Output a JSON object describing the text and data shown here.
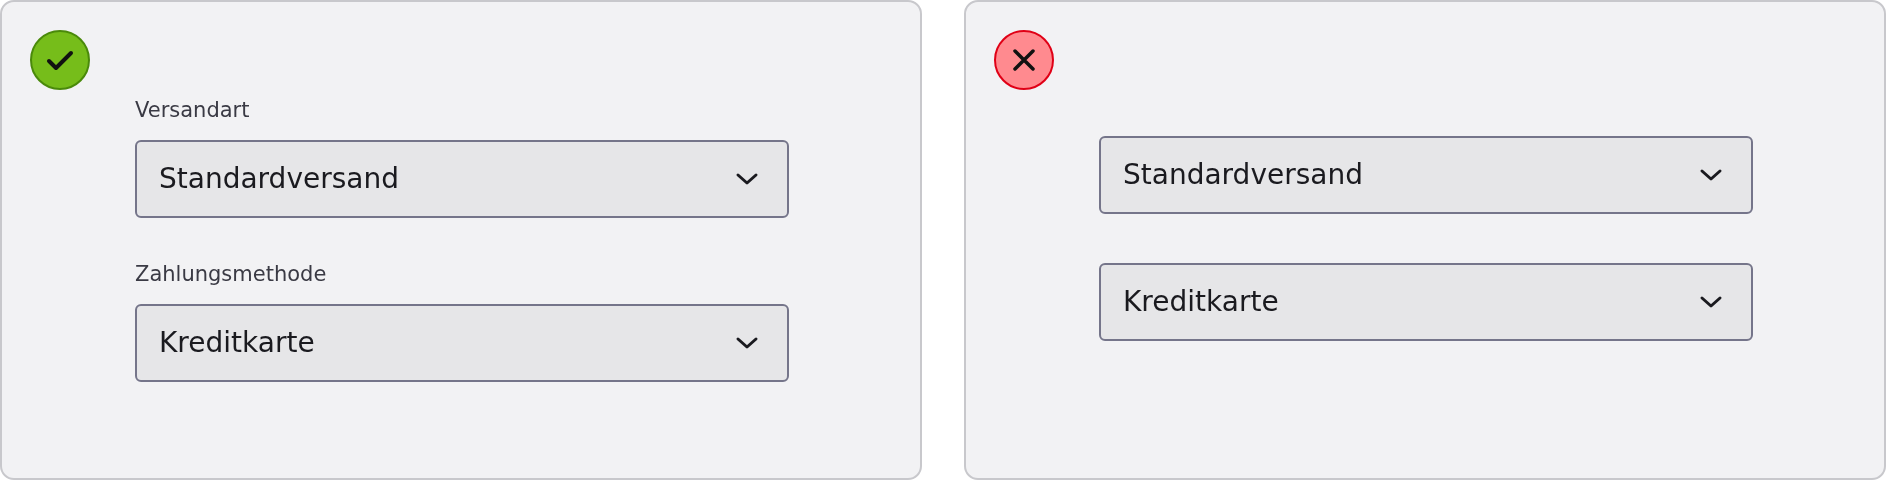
{
  "examples": [
    {
      "kind": "correct",
      "fields": [
        {
          "label": "Versandart",
          "value": "Standardversand"
        },
        {
          "label": "Zahlungsmethode",
          "value": "Kreditkarte"
        }
      ]
    },
    {
      "kind": "incorrect",
      "fields": [
        {
          "value": "Standardversand"
        },
        {
          "value": "Kreditkarte"
        }
      ]
    }
  ]
}
